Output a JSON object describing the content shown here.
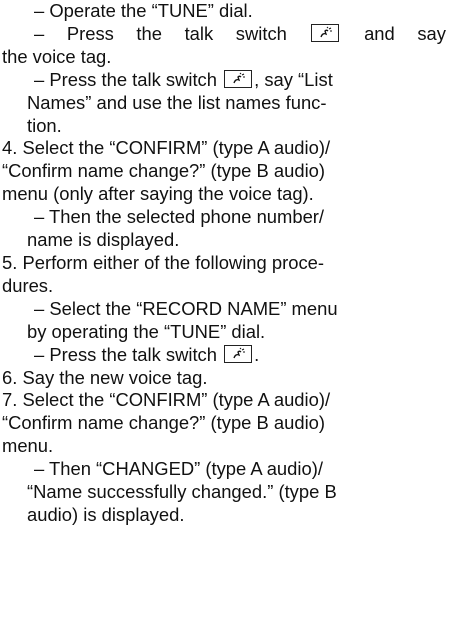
{
  "dash": "–",
  "lines": [
    "Operate the “TUNE” dial.",
    "Press the talk switch",
    "and say",
    "the voice tag.",
    "Press the talk switch",
    ", say “List",
    "Names” and use the list names func-",
    "tion.",
    "4.  Select the “CONFIRM” (type A audio)/",
    "“Confirm name change?” (type B audio)",
    "menu (only after saying the voice tag).",
    "Then the selected phone number/",
    "name is displayed.",
    "5.  Perform either of the following proce-",
    "dures.",
    "Select the “RECORD NAME” menu",
    "by operating the “TUNE” dial.",
    "Press the talk switch",
    ".",
    "6.  Say the new voice tag.",
    "7.  Select the “CONFIRM” (type A audio)/",
    "“Confirm name change?” (type B audio)",
    "menu.",
    "Then “CHANGED” (type A audio)/",
    "“Name successfully changed.” (type B",
    "audio) is displayed."
  ],
  "icons": {
    "talk_switch": "talk-switch-icon"
  }
}
